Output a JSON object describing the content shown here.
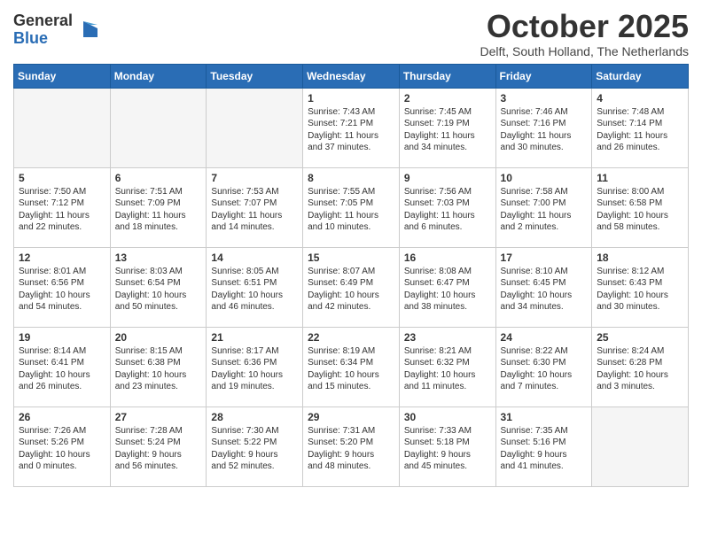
{
  "logo": {
    "general": "General",
    "blue": "Blue"
  },
  "header": {
    "month": "October 2025",
    "location": "Delft, South Holland, The Netherlands"
  },
  "days_of_week": [
    "Sunday",
    "Monday",
    "Tuesday",
    "Wednesday",
    "Thursday",
    "Friday",
    "Saturday"
  ],
  "weeks": [
    [
      {
        "day": "",
        "info": "",
        "empty": true
      },
      {
        "day": "",
        "info": "",
        "empty": true
      },
      {
        "day": "",
        "info": "",
        "empty": true
      },
      {
        "day": "1",
        "info": "Sunrise: 7:43 AM\nSunset: 7:21 PM\nDaylight: 11 hours\nand 37 minutes.",
        "empty": false
      },
      {
        "day": "2",
        "info": "Sunrise: 7:45 AM\nSunset: 7:19 PM\nDaylight: 11 hours\nand 34 minutes.",
        "empty": false
      },
      {
        "day": "3",
        "info": "Sunrise: 7:46 AM\nSunset: 7:16 PM\nDaylight: 11 hours\nand 30 minutes.",
        "empty": false
      },
      {
        "day": "4",
        "info": "Sunrise: 7:48 AM\nSunset: 7:14 PM\nDaylight: 11 hours\nand 26 minutes.",
        "empty": false
      }
    ],
    [
      {
        "day": "5",
        "info": "Sunrise: 7:50 AM\nSunset: 7:12 PM\nDaylight: 11 hours\nand 22 minutes.",
        "empty": false
      },
      {
        "day": "6",
        "info": "Sunrise: 7:51 AM\nSunset: 7:09 PM\nDaylight: 11 hours\nand 18 minutes.",
        "empty": false
      },
      {
        "day": "7",
        "info": "Sunrise: 7:53 AM\nSunset: 7:07 PM\nDaylight: 11 hours\nand 14 minutes.",
        "empty": false
      },
      {
        "day": "8",
        "info": "Sunrise: 7:55 AM\nSunset: 7:05 PM\nDaylight: 11 hours\nand 10 minutes.",
        "empty": false
      },
      {
        "day": "9",
        "info": "Sunrise: 7:56 AM\nSunset: 7:03 PM\nDaylight: 11 hours\nand 6 minutes.",
        "empty": false
      },
      {
        "day": "10",
        "info": "Sunrise: 7:58 AM\nSunset: 7:00 PM\nDaylight: 11 hours\nand 2 minutes.",
        "empty": false
      },
      {
        "day": "11",
        "info": "Sunrise: 8:00 AM\nSunset: 6:58 PM\nDaylight: 10 hours\nand 58 minutes.",
        "empty": false
      }
    ],
    [
      {
        "day": "12",
        "info": "Sunrise: 8:01 AM\nSunset: 6:56 PM\nDaylight: 10 hours\nand 54 minutes.",
        "empty": false
      },
      {
        "day": "13",
        "info": "Sunrise: 8:03 AM\nSunset: 6:54 PM\nDaylight: 10 hours\nand 50 minutes.",
        "empty": false
      },
      {
        "day": "14",
        "info": "Sunrise: 8:05 AM\nSunset: 6:51 PM\nDaylight: 10 hours\nand 46 minutes.",
        "empty": false
      },
      {
        "day": "15",
        "info": "Sunrise: 8:07 AM\nSunset: 6:49 PM\nDaylight: 10 hours\nand 42 minutes.",
        "empty": false
      },
      {
        "day": "16",
        "info": "Sunrise: 8:08 AM\nSunset: 6:47 PM\nDaylight: 10 hours\nand 38 minutes.",
        "empty": false
      },
      {
        "day": "17",
        "info": "Sunrise: 8:10 AM\nSunset: 6:45 PM\nDaylight: 10 hours\nand 34 minutes.",
        "empty": false
      },
      {
        "day": "18",
        "info": "Sunrise: 8:12 AM\nSunset: 6:43 PM\nDaylight: 10 hours\nand 30 minutes.",
        "empty": false
      }
    ],
    [
      {
        "day": "19",
        "info": "Sunrise: 8:14 AM\nSunset: 6:41 PM\nDaylight: 10 hours\nand 26 minutes.",
        "empty": false
      },
      {
        "day": "20",
        "info": "Sunrise: 8:15 AM\nSunset: 6:38 PM\nDaylight: 10 hours\nand 23 minutes.",
        "empty": false
      },
      {
        "day": "21",
        "info": "Sunrise: 8:17 AM\nSunset: 6:36 PM\nDaylight: 10 hours\nand 19 minutes.",
        "empty": false
      },
      {
        "day": "22",
        "info": "Sunrise: 8:19 AM\nSunset: 6:34 PM\nDaylight: 10 hours\nand 15 minutes.",
        "empty": false
      },
      {
        "day": "23",
        "info": "Sunrise: 8:21 AM\nSunset: 6:32 PM\nDaylight: 10 hours\nand 11 minutes.",
        "empty": false
      },
      {
        "day": "24",
        "info": "Sunrise: 8:22 AM\nSunset: 6:30 PM\nDaylight: 10 hours\nand 7 minutes.",
        "empty": false
      },
      {
        "day": "25",
        "info": "Sunrise: 8:24 AM\nSunset: 6:28 PM\nDaylight: 10 hours\nand 3 minutes.",
        "empty": false
      }
    ],
    [
      {
        "day": "26",
        "info": "Sunrise: 7:26 AM\nSunset: 5:26 PM\nDaylight: 10 hours\nand 0 minutes.",
        "empty": false
      },
      {
        "day": "27",
        "info": "Sunrise: 7:28 AM\nSunset: 5:24 PM\nDaylight: 9 hours\nand 56 minutes.",
        "empty": false
      },
      {
        "day": "28",
        "info": "Sunrise: 7:30 AM\nSunset: 5:22 PM\nDaylight: 9 hours\nand 52 minutes.",
        "empty": false
      },
      {
        "day": "29",
        "info": "Sunrise: 7:31 AM\nSunset: 5:20 PM\nDaylight: 9 hours\nand 48 minutes.",
        "empty": false
      },
      {
        "day": "30",
        "info": "Sunrise: 7:33 AM\nSunset: 5:18 PM\nDaylight: 9 hours\nand 45 minutes.",
        "empty": false
      },
      {
        "day": "31",
        "info": "Sunrise: 7:35 AM\nSunset: 5:16 PM\nDaylight: 9 hours\nand 41 minutes.",
        "empty": false
      },
      {
        "day": "",
        "info": "",
        "empty": true
      }
    ]
  ]
}
